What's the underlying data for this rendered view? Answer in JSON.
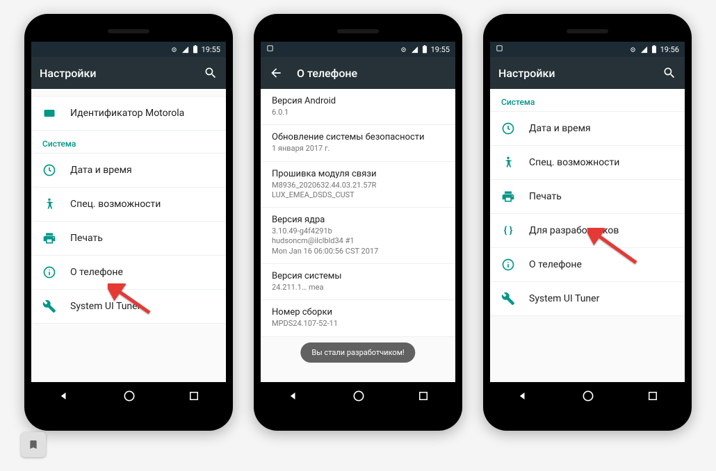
{
  "phone1": {
    "statusbar": {
      "time": "19:55"
    },
    "actionbar": {
      "title": "Настройки"
    },
    "rows": {
      "motorola": "Идентификатор Motorola",
      "section": "Система",
      "datetime": "Дата и время",
      "accessibility": "Спец. возможности",
      "print": "Печать",
      "about": "О телефоне",
      "tuner": "System UI Tuner"
    }
  },
  "phone2": {
    "statusbar": {
      "time": "19:55"
    },
    "actionbar": {
      "title": "О телефоне"
    },
    "items": [
      {
        "t": "Версия Android",
        "s": "6.0.1"
      },
      {
        "t": "Обновление системы безопасности",
        "s": "1 января 2017 г."
      },
      {
        "t": "Прошивка модуля связи",
        "s": "M8936_2020632.44.03.21.57R\nLUX_EMEA_DSDS_CUST"
      },
      {
        "t": "Версия ядра",
        "s": "3.10.49-g4f4291b\nhudsoncm@ilclbld34 #1\nMon Jan 16 06:00:56 CST 2017"
      },
      {
        "t": "Версия системы",
        "s": "24.211.1…                                    mea"
      },
      {
        "t": "Номер сборки",
        "s": "MPDS24.107-52-11"
      }
    ],
    "toast": "Вы стали разработчиком!"
  },
  "phone3": {
    "statusbar": {
      "time": "19:56"
    },
    "actionbar": {
      "title": "Настройки"
    },
    "rows": {
      "section": "Система",
      "datetime": "Дата и время",
      "accessibility": "Спец. возможности",
      "print": "Печать",
      "developer": "Для разработчиков",
      "about": "О телефоне",
      "tuner": "System UI Tuner"
    }
  }
}
